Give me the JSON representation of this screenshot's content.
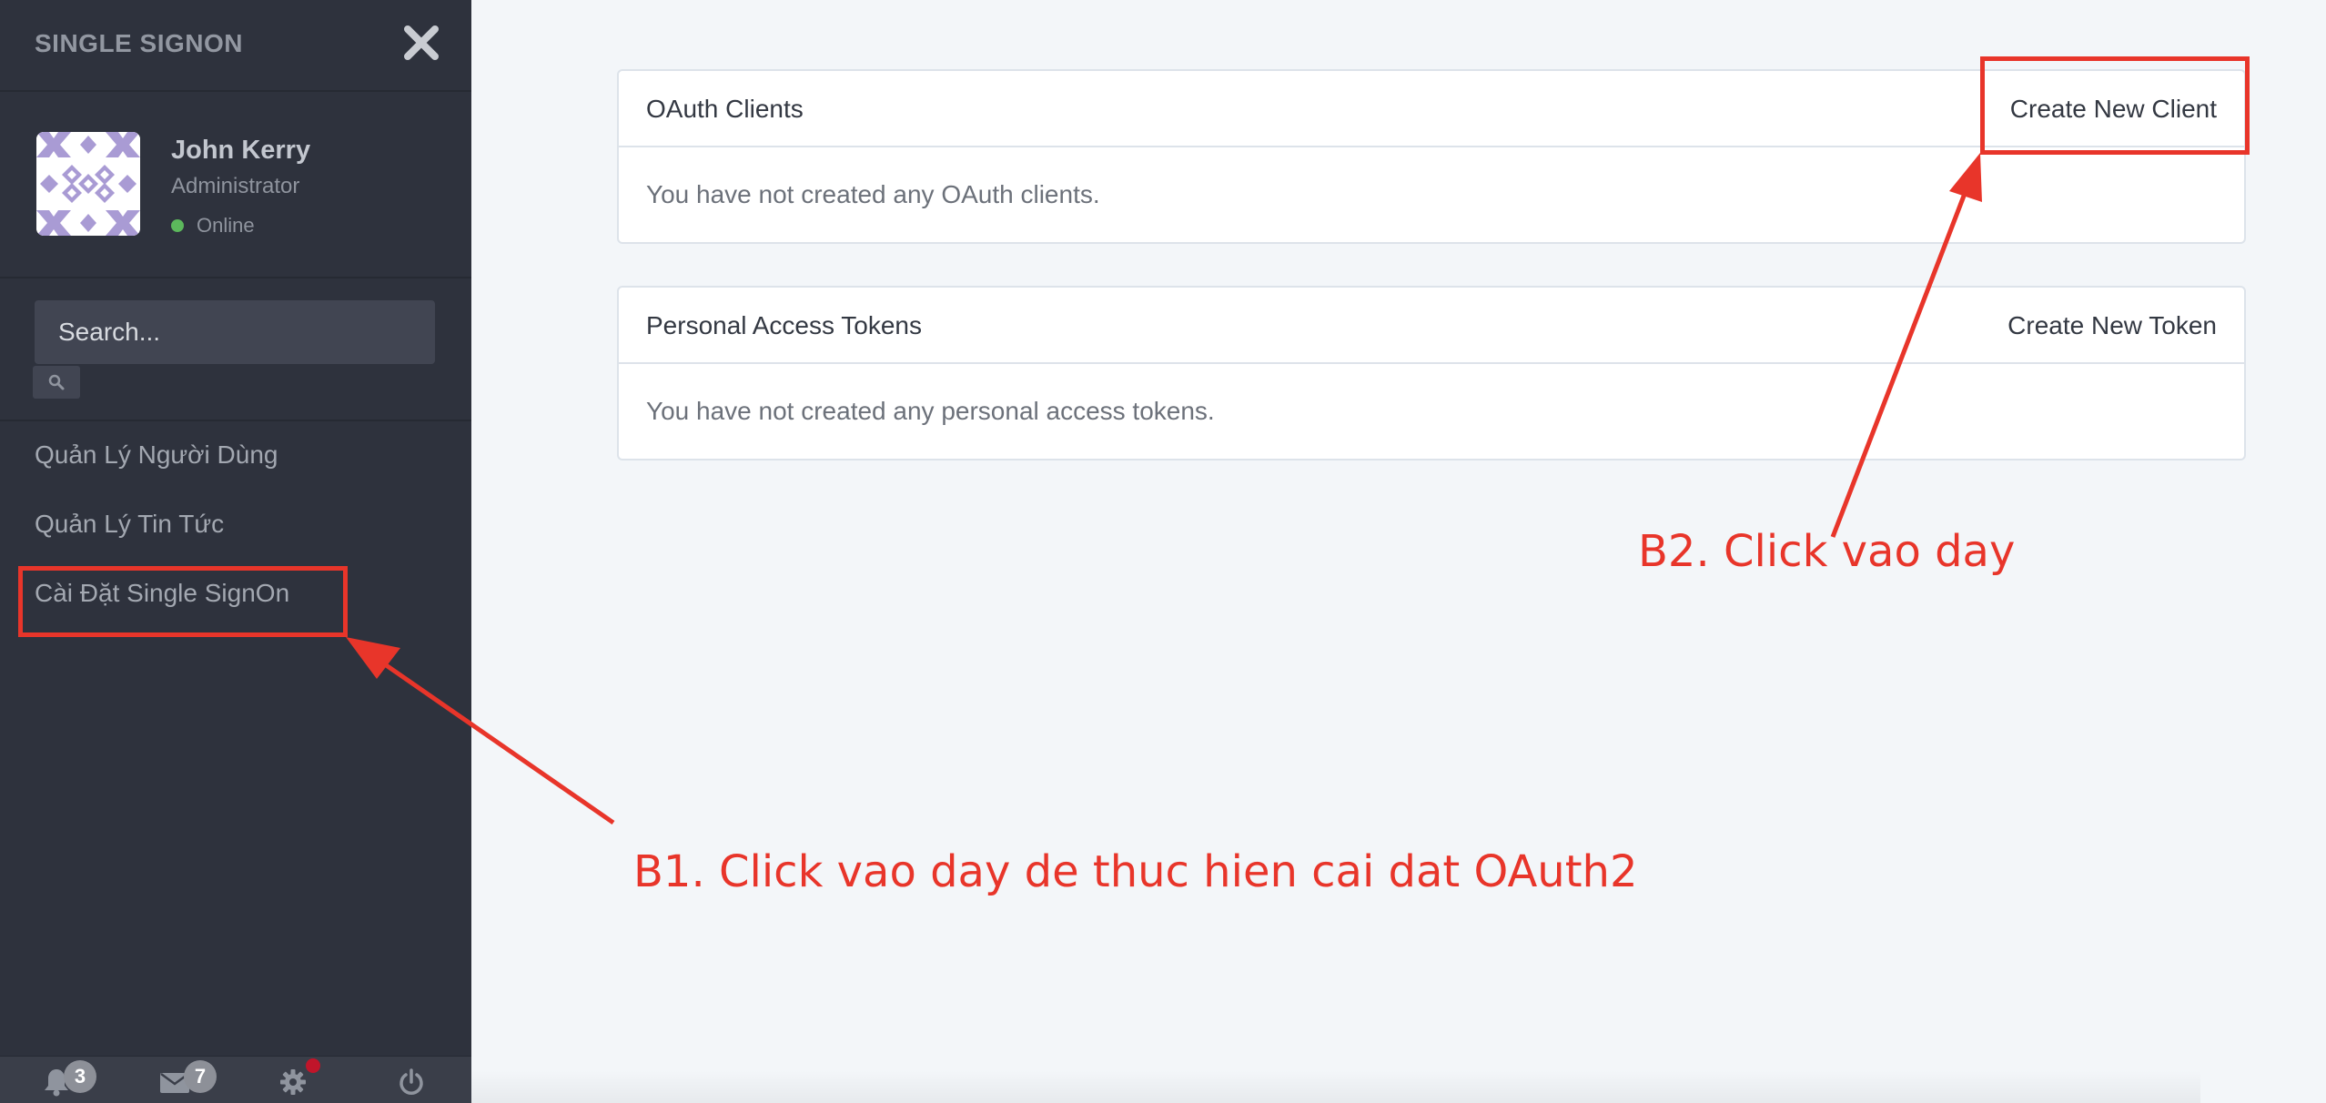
{
  "sidebar": {
    "brand": "SINGLE SIGNON",
    "user": {
      "name": "John Kerry",
      "role": "Administrator",
      "status": "Online"
    },
    "search": {
      "placeholder": "Search..."
    },
    "menu": [
      {
        "label": "Quản Lý Người Dùng"
      },
      {
        "label": "Quản Lý Tin Tức"
      },
      {
        "label": "Cài Đặt Single SignOn"
      }
    ],
    "footer": {
      "notifications_count": "3",
      "messages_count": "7"
    }
  },
  "main": {
    "oauth_clients": {
      "title": "OAuth Clients",
      "action": "Create New Client",
      "empty_message": "You have not created any OAuth clients."
    },
    "personal_tokens": {
      "title": "Personal Access Tokens",
      "action": "Create New Token",
      "empty_message": "You have not created any personal access tokens."
    }
  },
  "annotations": {
    "step1": "B1. Click vao day de thuc hien cai dat OAuth2",
    "step2": "B2. Click vao day"
  },
  "colors": {
    "sidebar_bg": "#2e323d",
    "main_bg": "#f3f6f9",
    "annotation_red": "#e8352a",
    "status_online": "#5cb85c",
    "avatar_pattern": "#a99bd4"
  },
  "icons": [
    "close-icon",
    "avatar",
    "search-icon",
    "bell-icon",
    "envelope-icon",
    "gear-icon",
    "power-icon"
  ]
}
